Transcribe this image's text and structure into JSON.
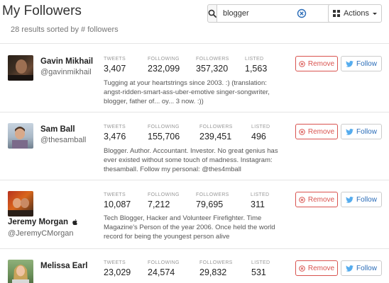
{
  "header": {
    "title": "My Followers",
    "subtitle": "28 results sorted by # followers"
  },
  "search": {
    "value": "blogger",
    "icon": "search-icon",
    "clear_icon": "clear-circle-icon"
  },
  "actions": {
    "label": "Actions",
    "icon": "grid-icon"
  },
  "stat_labels": {
    "tweets": "TWEETS",
    "following": "FOLLOWING",
    "followers": "FOLLOWERS",
    "listed": "LISTED"
  },
  "buttons": {
    "remove": "Remove",
    "follow": "Follow"
  },
  "colors": {
    "remove": "#d9534f",
    "follow": "#2a6cb8",
    "twitter": "#55acee"
  },
  "followers": [
    {
      "name": "Gavin Mikhail",
      "handle": "@gavinmikhail",
      "tweets": "3,407",
      "following": "232,099",
      "followers": "357,320",
      "listed": "1,563",
      "bio": "Tugging at your heartstrings since 2003. :) (translation: angst-ridden-smart-ass-uber-emotive singer-songwriter, blogger, father of... oy... 3 now. :))"
    },
    {
      "name": "Sam Ball",
      "handle": "@thesamball",
      "tweets": "3,476",
      "following": "155,706",
      "followers": "239,451",
      "listed": "496",
      "bio": "Blogger. Author. Accountant. Investor. No great genius has ever existed without some touch of madness. Instagram: thesamball. Follow my personal: @thes4mball"
    },
    {
      "name": "Jeremy Morgan",
      "handle": "@JeremyCMorgan",
      "tweets": "10,087",
      "following": "7,212",
      "followers": "79,695",
      "listed": "311",
      "bio": "Tech Blogger, Hacker and Volunteer Firefighter. Time Magazine's Person of the year 2006. Once held the world record for being the youngest person alive"
    },
    {
      "name": "Melissa Earl",
      "handle": "",
      "tweets": "23,029",
      "following": "24,574",
      "followers": "29,832",
      "listed": "531",
      "bio": ""
    }
  ]
}
